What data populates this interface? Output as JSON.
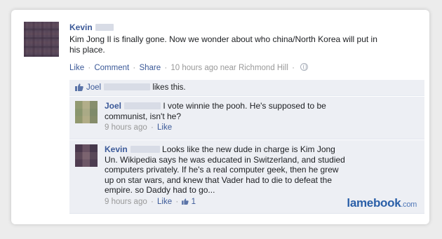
{
  "post": {
    "author": "Kevin",
    "text": "Kim Jong Il is finally gone. Now we wonder about who china/North Korea will put in his place.",
    "actions": {
      "like": "Like",
      "comment": "Comment",
      "share": "Share",
      "time": "10 hours ago near Richmond Hill"
    }
  },
  "likes": {
    "name": "Joel",
    "suffix": "likes this."
  },
  "comments": [
    {
      "author": "Joel",
      "text": "I vote winnie the pooh. He's supposed to be communist, isn't he?",
      "time": "9 hours ago",
      "like": "Like"
    },
    {
      "author": "Kevin",
      "text": "Looks like the new dude in charge is Kim Jong Un. Wikipedia says he was educated in Switzerland, and studied computers privately. If he's a real computer geek, then he grew up on star wars, and knew that Vader had to die to defeat the empire. so Daddy had to go...",
      "time": "9 hours ago",
      "like": "Like",
      "like_count": "1"
    }
  ],
  "watermark": {
    "brand": "lamebook",
    "tld": ".com"
  },
  "colors": {
    "link": "#3b5998",
    "panel": "#edeff4",
    "meta": "#999999"
  }
}
